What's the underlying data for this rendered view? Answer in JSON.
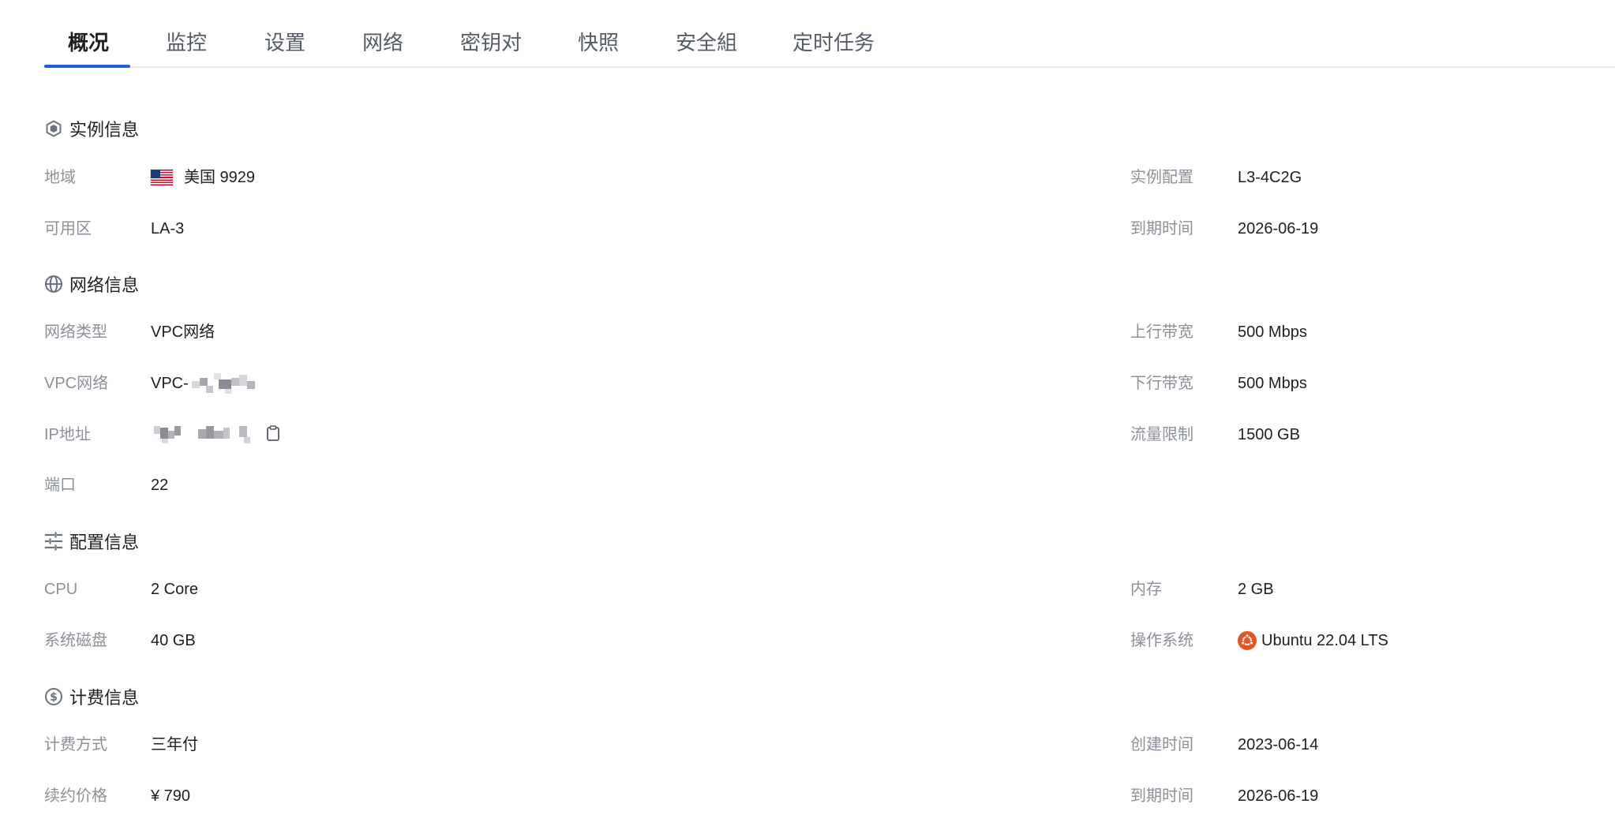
{
  "tabs": [
    {
      "label": "概况",
      "active": true
    },
    {
      "label": "监控",
      "active": false
    },
    {
      "label": "设置",
      "active": false
    },
    {
      "label": "网络",
      "active": false
    },
    {
      "label": "密钥对",
      "active": false
    },
    {
      "label": "快照",
      "active": false
    },
    {
      "label": "安全組",
      "active": false
    },
    {
      "label": "定时任务",
      "active": false
    }
  ],
  "accent_color": "#1f61d9",
  "sections": {
    "instance": {
      "title": "实例信息",
      "icon": "cube-icon",
      "region_label": "地域",
      "region_value": "美国 9929",
      "region_flag": "us-flag-icon",
      "zone_label": "可用区",
      "zone_value": "LA-3",
      "spec_label": "实例配置",
      "spec_value": "L3-4C2G",
      "expire_label": "到期时间",
      "expire_value": "2026-06-19"
    },
    "network": {
      "title": "网络信息",
      "icon": "globe-icon",
      "type_label": "网络类型",
      "type_value": "VPC网络",
      "vpc_label": "VPC网络",
      "vpc_value_prefix": "VPC-",
      "ip_label": "IP地址",
      "port_label": "端口",
      "port_value": "22",
      "up_label": "上行带宽",
      "up_value": "500 Mbps",
      "down_label": "下行带宽",
      "down_value": "500 Mbps",
      "traffic_label": "流量限制",
      "traffic_value": "1500 GB"
    },
    "config": {
      "title": "配置信息",
      "icon": "sliders-icon",
      "cpu_label": "CPU",
      "cpu_value": "2 Core",
      "disk_label": "系统磁盘",
      "disk_value": "40 GB",
      "mem_label": "内存",
      "mem_value": "2 GB",
      "os_label": "操作系统",
      "os_value": "Ubuntu 22.04 LTS",
      "os_icon": "ubuntu-icon"
    },
    "billing": {
      "title": "计费信息",
      "icon": "dollar-icon",
      "method_label": "计费方式",
      "method_value": "三年付",
      "renew_label": "续约价格",
      "renew_value": "¥ 790",
      "created_label": "创建时间",
      "created_value": "2023-06-14",
      "expire_label": "到期时间",
      "expire_value": "2026-06-19"
    }
  }
}
